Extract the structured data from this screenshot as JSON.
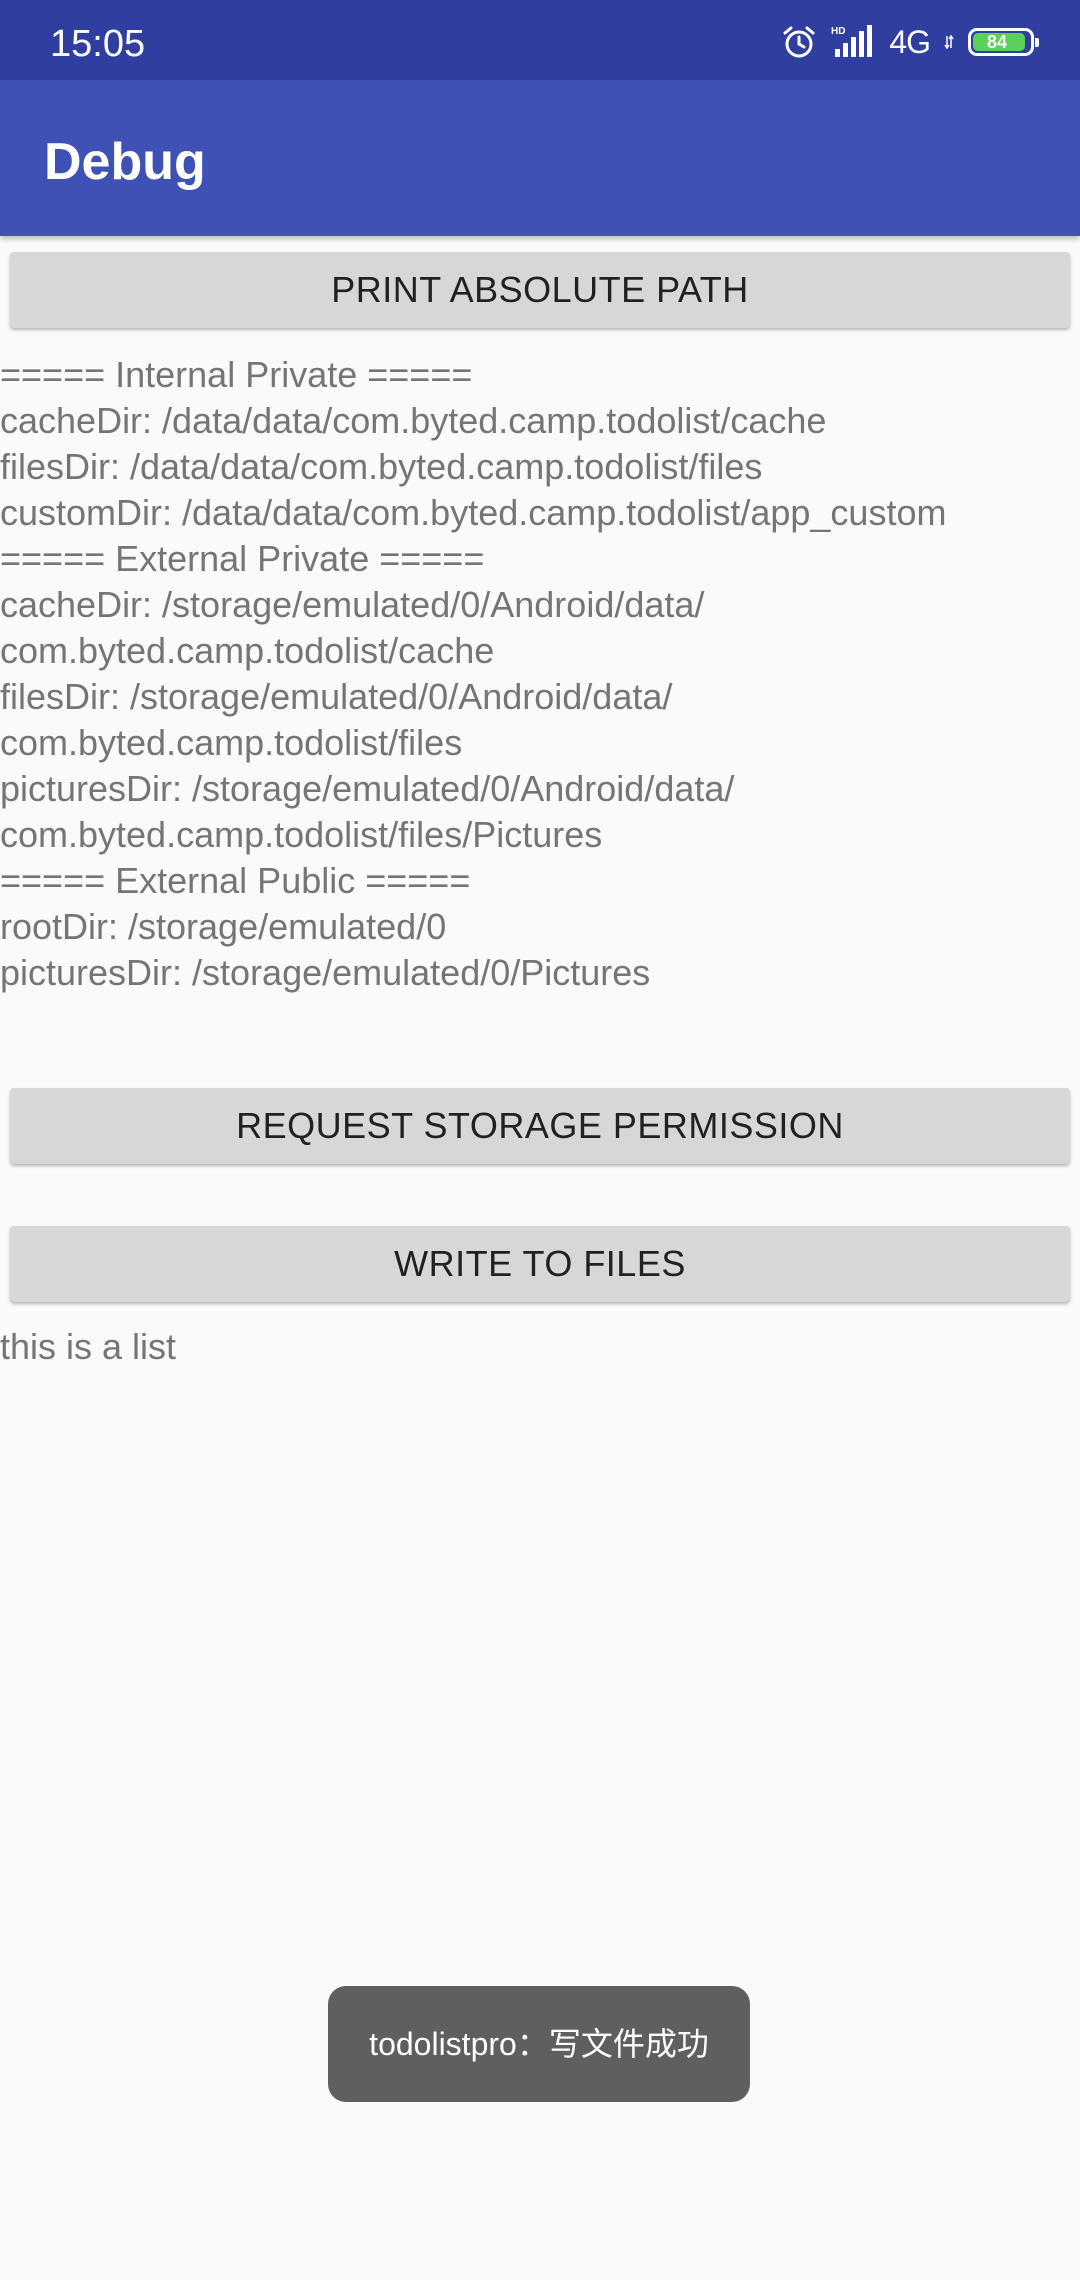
{
  "status_bar": {
    "time": "15:05",
    "network": "4G",
    "battery_level": "84",
    "icons": [
      "alarm-icon",
      "hd-signal-icon",
      "network-4g-icon",
      "battery-icon"
    ]
  },
  "app_bar": {
    "title": "Debug"
  },
  "buttons": {
    "print_path": "PRINT ABSOLUTE PATH",
    "request_permission": "REQUEST STORAGE PERMISSION",
    "write_files": "WRITE TO FILES"
  },
  "path_output": [
    "===== Internal Private =====",
    "cacheDir: /data/data/com.byted.camp.todolist/cache",
    "filesDir: /data/data/com.byted.camp.todolist/files",
    "customDir: /data/data/com.byted.camp.todolist/app_custom",
    "===== External Private =====",
    "cacheDir: /storage/emulated/0/Android/data/",
    "com.byted.camp.todolist/cache",
    "filesDir: /storage/emulated/0/Android/data/",
    "com.byted.camp.todolist/files",
    "picturesDir: /storage/emulated/0/Android/data/",
    "com.byted.camp.todolist/files/Pictures",
    "===== External Public =====",
    "rootDir: /storage/emulated/0",
    "picturesDir: /storage/emulated/0/Pictures"
  ],
  "file_content": "this is a list",
  "toast": {
    "message": "todolistpro：写文件成功"
  },
  "colors": {
    "status_bar": "#303f9f",
    "app_bar": "#3f51b5",
    "background": "#fafafa",
    "button": "#d6d7d7",
    "battery": "#5bd15b",
    "toast": "#5f5f5f"
  }
}
